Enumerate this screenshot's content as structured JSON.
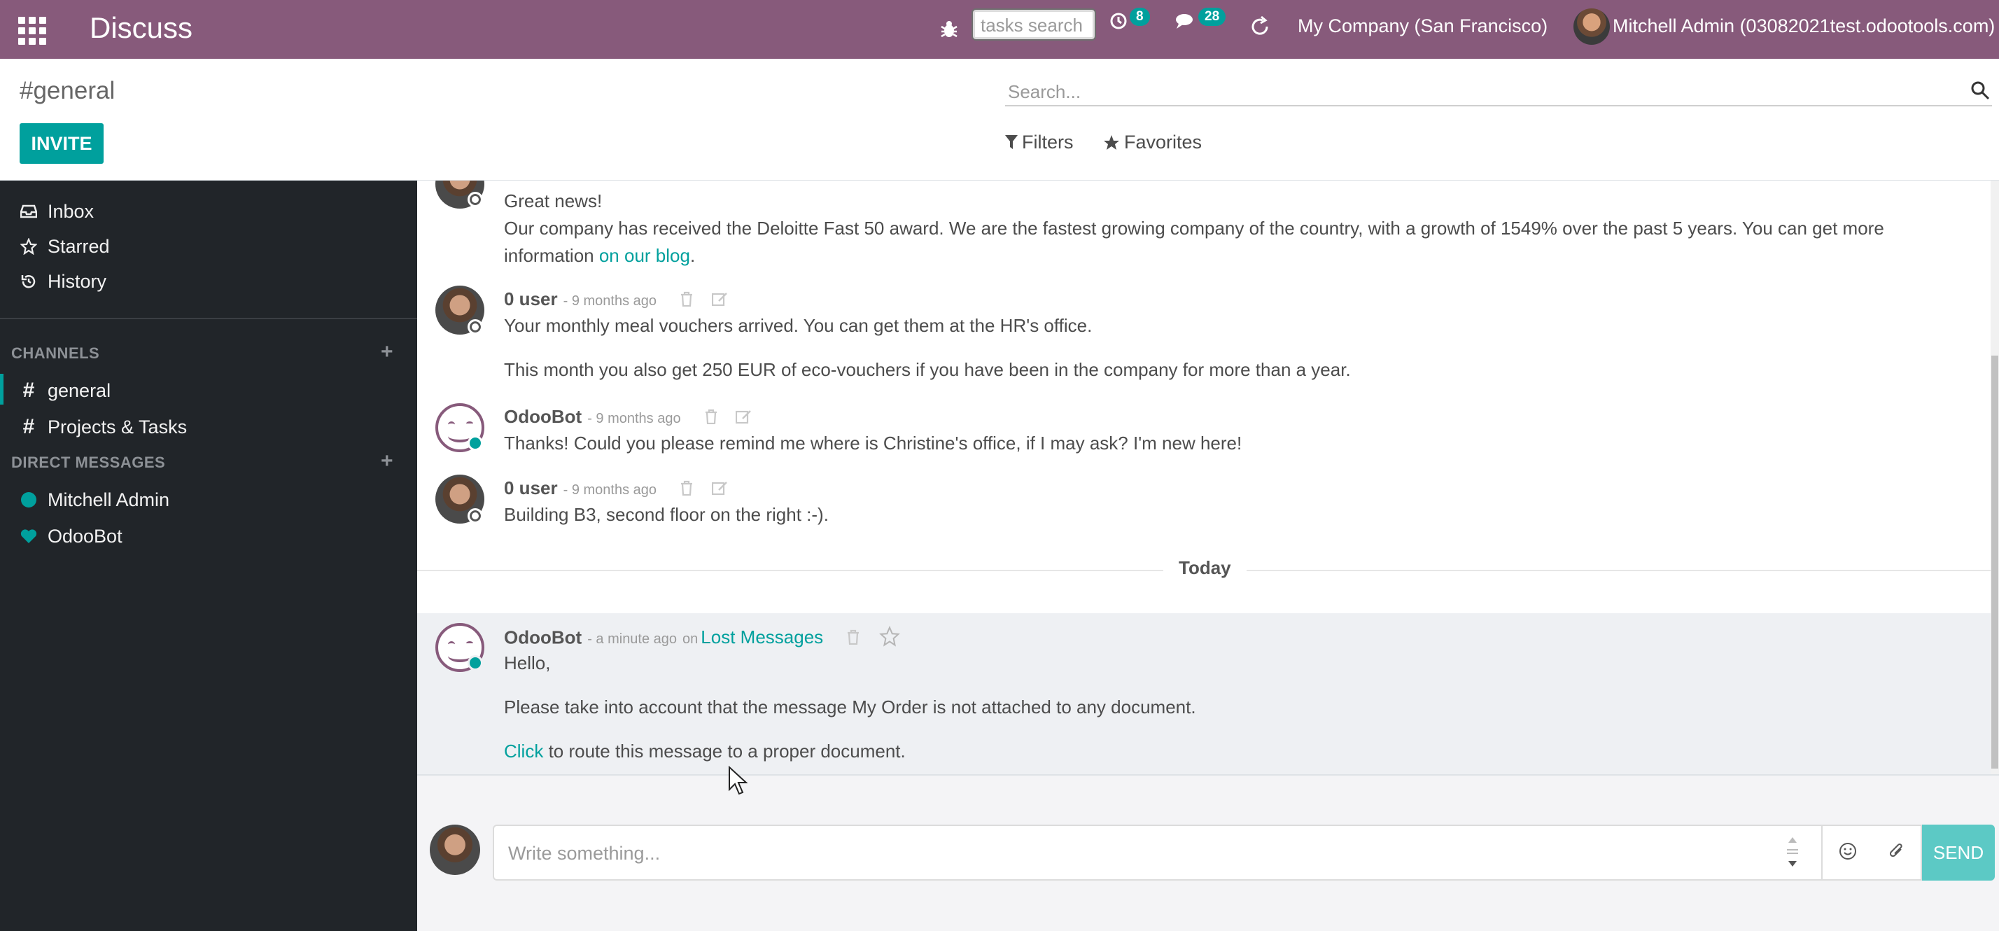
{
  "app": {
    "title": "Discuss"
  },
  "navbar": {
    "tasks_search_placeholder": "tasks search",
    "activity_count": "8",
    "messages_count": "28",
    "company": "My Company (San Francisco)",
    "user": "Mitchell Admin (03082021test.odootools.com)"
  },
  "control_panel": {
    "breadcrumb": "#general",
    "invite_label": "INVITE",
    "search_placeholder": "Search...",
    "filters_label": "Filters",
    "favorites_label": "Favorites"
  },
  "sidebar": {
    "mailboxes": [
      {
        "label": "Inbox",
        "icon": "inbox-icon"
      },
      {
        "label": "Starred",
        "icon": "star-icon"
      },
      {
        "label": "History",
        "icon": "history-icon"
      }
    ],
    "channels_header": "CHANNELS",
    "channels": [
      {
        "label": "general",
        "active": true
      },
      {
        "label": "Projects & Tasks",
        "active": false
      }
    ],
    "dm_header": "DIRECT MESSAGES",
    "direct_messages": [
      {
        "label": "Mitchell Admin",
        "icon": "online-dot-icon"
      },
      {
        "label": "OdooBot",
        "icon": "heart-icon"
      }
    ]
  },
  "thread": {
    "messages": [
      {
        "author": "",
        "date": "",
        "lines": [
          "Great news!",
          "Our company has received the Deloitte Fast 50 award. We are the fastest growing company of the country, with a growth of 1549% over the past 5 years. You can get more",
          "information "
        ],
        "link_text": "on our blog",
        "link_suffix": "."
      },
      {
        "author": "0 user",
        "date": "- 9 months ago",
        "lines": [
          "Your monthly meal vouchers arrived. You can get them at the HR's office.",
          "This month you also get 250 EUR of eco-vouchers if you have been in the company for more than a year."
        ]
      },
      {
        "author": "OdooBot",
        "date": "- 9 months ago",
        "lines": [
          "Thanks! Could you please remind me where is Christine's office, if I may ask? I'm new here!"
        ]
      },
      {
        "author": "0 user",
        "date": "- 9 months ago",
        "lines": [
          "Building B3, second floor on the right :-)."
        ]
      }
    ],
    "separator": "Today",
    "latest": {
      "author": "OdooBot",
      "date": "- a minute ago",
      "on": "on",
      "origin": "Lost Messages",
      "lines": [
        "Hello,",
        "Please take into account that the message My Order is not attached to any document."
      ],
      "click_link": "Click",
      "click_suffix": " to route this message to a proper document."
    }
  },
  "composer": {
    "placeholder": "Write something...",
    "send_label": "SEND"
  },
  "colors": {
    "brand": "#875a7b",
    "accent": "#00a09d",
    "sidebar": "#212529"
  }
}
